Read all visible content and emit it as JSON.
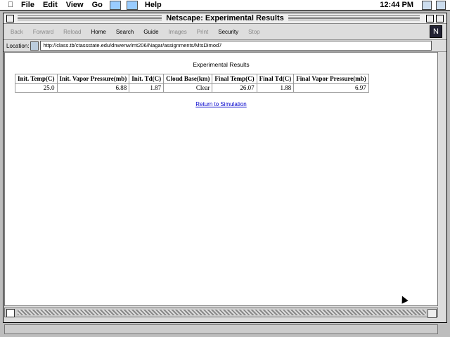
{
  "menubar": {
    "apple": "",
    "items": [
      "File",
      "Edit",
      "View",
      "Go",
      "Help"
    ],
    "clock": "12:44 PM"
  },
  "window": {
    "title": "Netscape: Experimental Results"
  },
  "toolbar": {
    "buttons": [
      "Back",
      "Forward",
      "Reload",
      "Home",
      "Search",
      "Guide",
      "Images",
      "Print",
      "Security",
      "Stop"
    ]
  },
  "location": {
    "label": "Location:",
    "url": "http://class.tb/ctassstate.edu/dnwenw/mt206/Nagar/assignments/MtsDimod7"
  },
  "page": {
    "caption": "Experimental Results",
    "table": {
      "headers": [
        "Init. Temp(C)",
        "Init. Vapor Pressure(mb)",
        "Init. Td(C)",
        "Cloud Base(km)",
        "Final Temp(C)",
        "Final Td(C)",
        "Final Vapor Pressure(mb)"
      ],
      "rows": [
        [
          "25.0",
          "6.88",
          "1.87",
          "Clear",
          "26.07",
          "1.88",
          "6.97"
        ]
      ]
    },
    "return_link": "Return to Simulation"
  }
}
